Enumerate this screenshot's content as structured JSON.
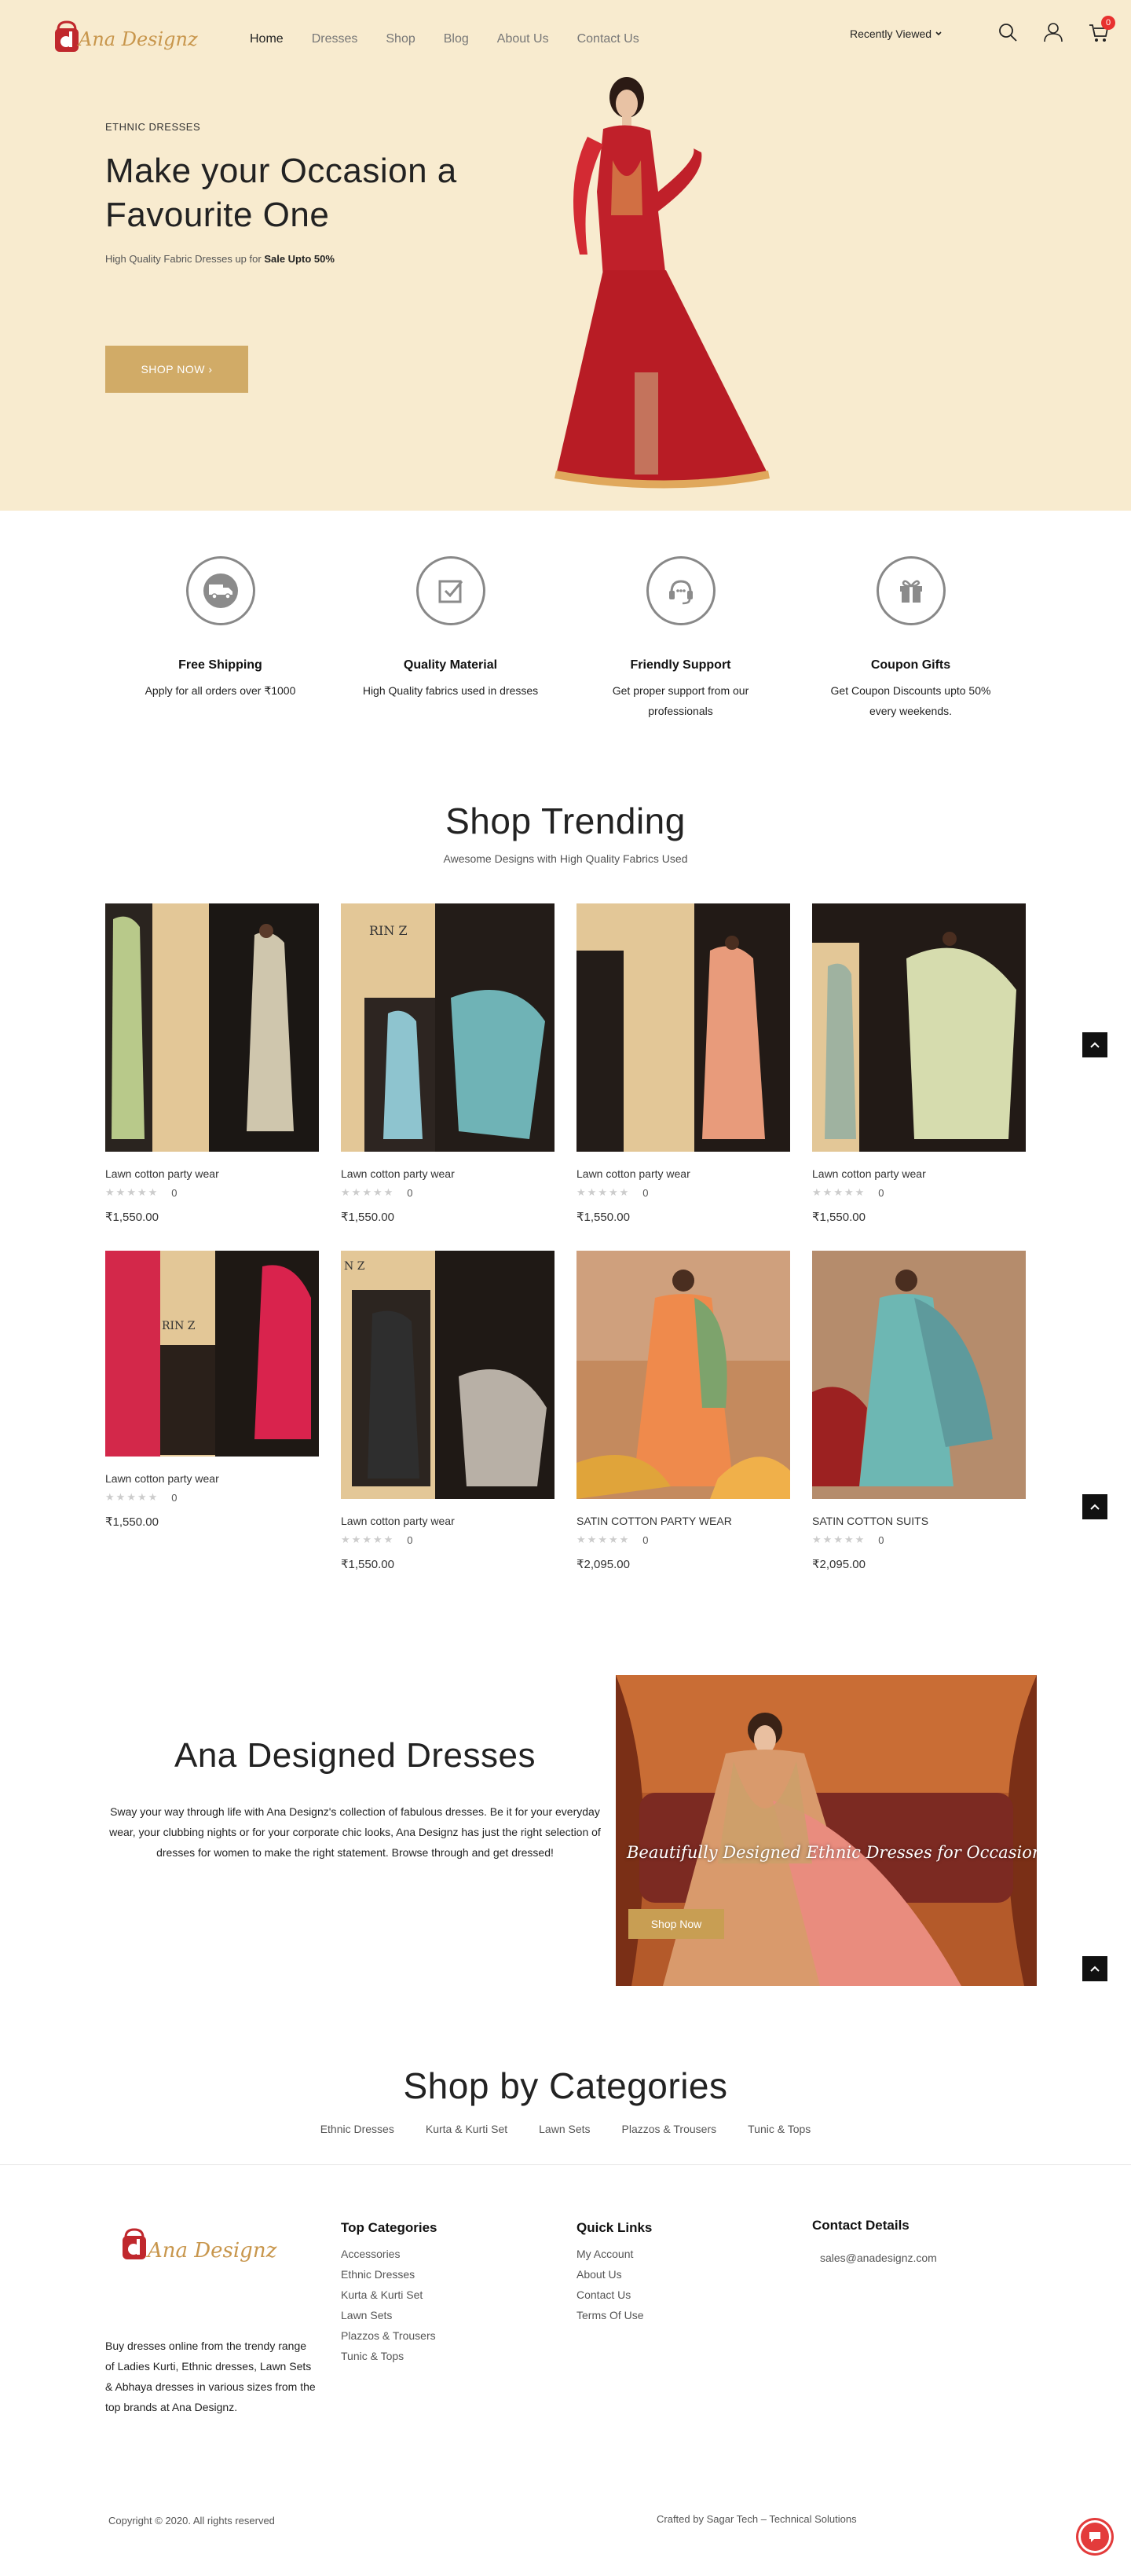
{
  "brand": {
    "name": "Ana Designz",
    "accent": "#d1ab67",
    "hero_bg": "#f8ebcf"
  },
  "nav": {
    "items": [
      {
        "label": "Home"
      },
      {
        "label": "Dresses"
      },
      {
        "label": "Shop"
      },
      {
        "label": "Blog"
      },
      {
        "label": "About Us"
      },
      {
        "label": "Contact Us"
      }
    ],
    "active": "Home",
    "recently_viewed": "Recently Viewed",
    "icons": [
      "search-icon",
      "user-icon",
      "cart-icon"
    ],
    "cart_count": "0"
  },
  "hero": {
    "kicker": "ETHNIC DRESSES",
    "title": "Make your Occasion a Favourite One",
    "subtitle_prefix": "High Quality Fabric Dresses up for",
    "subtitle_bold": "Sale Upto 50%",
    "button": "SHOP NOW ›"
  },
  "features": [
    {
      "icon": "truck-icon",
      "title": "Free Shipping",
      "desc": "Apply for all orders over ₹1000"
    },
    {
      "icon": "checkbox-icon",
      "title": "Quality Material",
      "desc": "High Quality fabrics used in dresses"
    },
    {
      "icon": "headset-icon",
      "title": "Friendly Support",
      "desc": "Get proper support from our professionals"
    },
    {
      "icon": "gift-icon",
      "title": "Coupon Gifts",
      "desc": "Get Coupon Discounts upto 50% every weekends."
    }
  ],
  "trending": {
    "title": "Shop Trending",
    "subtitle": "Awesome Designs with High Quality Fabrics Used",
    "products": [
      {
        "name": "Lawn cotton party wear",
        "reviews": "0",
        "price": "₹1,550.00"
      },
      {
        "name": "Lawn cotton party wear",
        "reviews": "0",
        "price": "₹1,550.00"
      },
      {
        "name": "Lawn cotton party wear",
        "reviews": "0",
        "price": "₹1,550.00"
      },
      {
        "name": "Lawn cotton party wear",
        "reviews": "0",
        "price": "₹1,550.00"
      },
      {
        "name": "Lawn cotton party wear",
        "reviews": "0",
        "price": "₹1,550.00"
      },
      {
        "name": "Lawn cotton party wear",
        "reviews": "0",
        "price": "₹1,550.00"
      },
      {
        "name": "SATIN COTTON PARTY WEAR",
        "reviews": "0",
        "price": "₹2,095.00"
      },
      {
        "name": "SATIN COTTON SUITS",
        "reviews": "0",
        "price": "₹2,095.00"
      }
    ]
  },
  "about": {
    "title": "Ana Designed Dresses",
    "text": "Sway your way through life with Ana Designz's collection of fabulous dresses. Be it for your everyday wear, your clubbing nights or for your corporate chic looks, Ana Designz has just the right selection of dresses for women to make the right statement. Browse through and get dressed!",
    "banner_text": "Beautifully Designed Ethnic Dresses for Occasions",
    "banner_button": "Shop Now"
  },
  "categories": {
    "title": "Shop by Categories",
    "links": [
      "Ethnic Dresses",
      "Kurta & Kurti Set",
      "Lawn Sets",
      "Plazzos & Trousers",
      "Tunic & Tops"
    ]
  },
  "footer": {
    "description": "Buy dresses online from the trendy range of Ladies Kurti, Ethnic dresses, Lawn Sets & Abhaya dresses in various sizes from the top brands at Ana Designz.",
    "top_categories": {
      "heading": "Top Categories",
      "links": [
        "Accessories",
        "Ethnic Dresses",
        "Kurta & Kurti Set",
        "Lawn Sets",
        "Plazzos & Trousers",
        "Tunic & Tops"
      ]
    },
    "quick_links": {
      "heading": "Quick Links",
      "links": [
        "My Account",
        "About Us",
        "Contact Us",
        "Terms Of Use"
      ]
    },
    "contact": {
      "heading": "Contact Details",
      "email": "sales@anadesignz.com"
    },
    "copyright": "Copyright © 2020. All rights reserved",
    "crafted": "Crafted by Sagar Tech – Technical Solutions"
  }
}
